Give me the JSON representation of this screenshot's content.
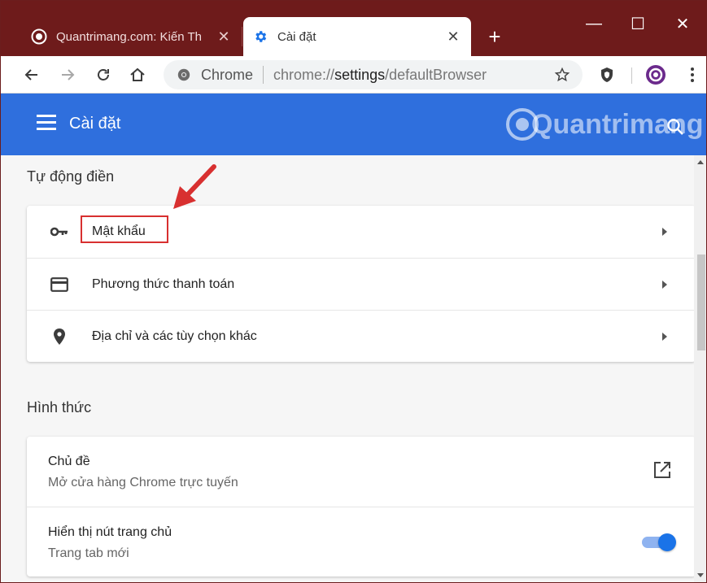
{
  "browser": {
    "tabs": [
      {
        "title": "Quantrimang.com: Kiến Th",
        "close": "✕",
        "active": false,
        "favicon": "quantrimang-logo-icon"
      },
      {
        "title": "Cài đặt",
        "close": "✕",
        "active": true,
        "favicon": "gear-icon"
      }
    ],
    "new_tab": "+",
    "window_controls": {
      "minimize": "—",
      "maximize": "☐",
      "close": "✕"
    },
    "omnibox": {
      "chip": "Chrome",
      "url_scheme": "chrome://",
      "url_host": "settings",
      "url_path": "/defaultBrowser"
    }
  },
  "settings_header": {
    "title": "Cài đặt",
    "watermark": "Quantrimang"
  },
  "autofill": {
    "section_title": "Tự động điền",
    "items": [
      {
        "label": "Mật khẩu",
        "icon": "key-icon",
        "highlighted": true
      },
      {
        "label": "Phương thức thanh toán",
        "icon": "credit-card-icon"
      },
      {
        "label": "Địa chỉ và các tùy chọn khác",
        "icon": "location-pin-icon"
      }
    ]
  },
  "appearance": {
    "section_title": "Hình thức",
    "items": [
      {
        "primary": "Chủ đề",
        "secondary": "Mở cửa hàng Chrome trực tuyến",
        "control": "open-external-icon"
      },
      {
        "primary": "Hiển thị nút trang chủ",
        "secondary": "Trang tab mới",
        "control": "toggle",
        "toggle_on": true
      }
    ]
  },
  "colors": {
    "tabstrip": "#6e1b1b",
    "header": "#2f6fdd",
    "accent": "#1a73e8",
    "annotation_red": "#d83030"
  }
}
